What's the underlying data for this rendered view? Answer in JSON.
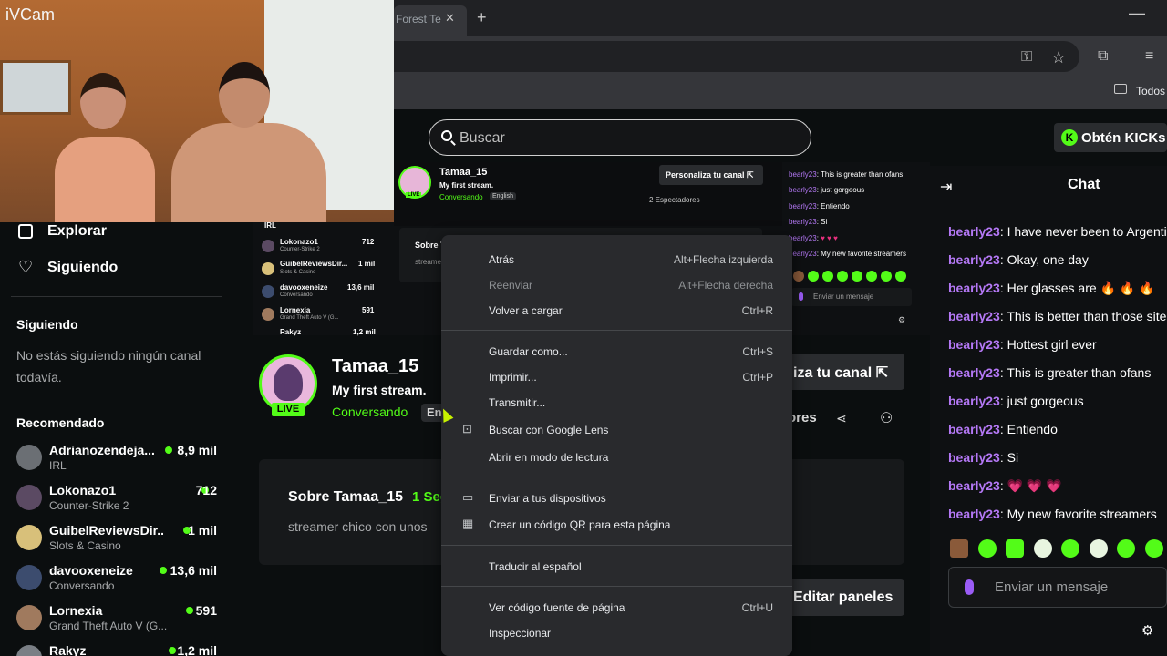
{
  "browser": {
    "tab_title": "Forest Te",
    "tab_close": "✕",
    "new_tab": "+",
    "minimize": "—",
    "bookmarks_label": "Todos"
  },
  "webcam": {
    "label": "iVCam"
  },
  "header": {
    "search_placeholder": "Buscar",
    "kicks_button": "Obtén KICKs",
    "kicks_logo": "K"
  },
  "sidebar": {
    "explore": "Explorar",
    "following": "Siguiendo",
    "following_heading": "Siguiendo",
    "not_following": "No estás siguiendo ningún canal todavía.",
    "recommended_heading": "Recomendado",
    "recommended": [
      {
        "name": "Adrianozendeja...",
        "category": "IRL",
        "viewers": "8,9 mil"
      },
      {
        "name": "Lokonazo1",
        "category": "Counter-Strike 2",
        "viewers": "712"
      },
      {
        "name": "GuibelReviewsDir...",
        "category": "Slots & Casino",
        "viewers": "1 mil"
      },
      {
        "name": "davooxeneize",
        "category": "Conversando",
        "viewers": "13,6 mil"
      },
      {
        "name": "Lornexia",
        "category": "Grand Theft Auto V (G...",
        "viewers": "591"
      },
      {
        "name": "Rakyz",
        "category": "",
        "viewers": "1,2 mil"
      }
    ]
  },
  "thumbnail": {
    "name": "Tamaa_15",
    "title": "My first stream.",
    "category": "Conversando",
    "language": "English",
    "live": "LIVE",
    "personalize": "Personaliza tu canal ⇱",
    "viewers": "2 Espectadores",
    "about_title": "Sobre T",
    "about_desc": "streame",
    "list": [
      {
        "name": "IRL",
        "sub": "",
        "num": ""
      },
      {
        "name": "Lokonazo1",
        "sub": "Counter-Strike 2",
        "num": "712"
      },
      {
        "name": "GuibelReviewsDir...",
        "sub": "Slots & Casino",
        "num": "1 mil"
      },
      {
        "name": "davooxeneize",
        "sub": "Conversando",
        "num": "13,6 mil"
      },
      {
        "name": "Lornexia",
        "sub": "Grand Theft Auto V (G...",
        "num": "591"
      },
      {
        "name": "Rakyz",
        "sub": "",
        "num": "1,2 mil"
      }
    ],
    "chat": [
      {
        "user": "bearly23",
        "text": "This is greater than ofans"
      },
      {
        "user": "bearly23",
        "text": "just gorgeous"
      },
      {
        "user": "bearly23",
        "text": "Entiendo"
      },
      {
        "user": "bearly23",
        "text": "Si"
      },
      {
        "user": "bearly23",
        "text": "♥ ♥ ♥"
      },
      {
        "user": "bearly23",
        "text": "My new favorite streamers"
      }
    ],
    "chat_placeholder": "Enviar un mensaje"
  },
  "channel": {
    "name": "Tamaa_15",
    "title": "My first stream.",
    "category": "Conversando",
    "language": "En",
    "live": "LIVE",
    "personalize": "iza tu canal ⇱",
    "viewers": "ores",
    "about_title": "Sobre Tamaa_15",
    "about_follow": "1 Seg",
    "about_desc": "streamer chico con unos",
    "edit_panels": "Editar paneles"
  },
  "chat": {
    "title": "Chat",
    "messages": [
      {
        "user": "bearly23",
        "text": "I have never been to Argentin"
      },
      {
        "user": "bearly23",
        "text": "Okay, one day"
      },
      {
        "user": "bearly23",
        "text": "Her glasses are 🔥 🔥 🔥"
      },
      {
        "user": "bearly23",
        "text": "This is better than those sites"
      },
      {
        "user": "bearly23",
        "text": "Hottest girl ever"
      },
      {
        "user": "bearly23",
        "text": "This is greater than ofans"
      },
      {
        "user": "bearly23",
        "text": "just gorgeous"
      },
      {
        "user": "bearly23",
        "text": "Entiendo"
      },
      {
        "user": "bearly23",
        "text": "Si"
      },
      {
        "user": "bearly23",
        "text": "💗 💗 💗"
      },
      {
        "user": "bearly23",
        "text": "My new favorite streamers"
      }
    ],
    "placeholder": "Enviar un mensaje"
  },
  "context_menu": {
    "items": [
      {
        "label": "Atrás",
        "shortcut": "Alt+Flecha izquierda"
      },
      {
        "label": "Reenviar",
        "shortcut": "Alt+Flecha derecha"
      },
      {
        "label": "Volver a cargar",
        "shortcut": "Ctrl+R"
      },
      {
        "label": "Guardar como...",
        "shortcut": "Ctrl+S"
      },
      {
        "label": "Imprimir...",
        "shortcut": "Ctrl+P"
      },
      {
        "label": "Transmitir...",
        "shortcut": ""
      },
      {
        "label": "Buscar con Google Lens",
        "shortcut": ""
      },
      {
        "label": "Abrir en modo de lectura",
        "shortcut": ""
      },
      {
        "label": "Enviar a tus dispositivos",
        "shortcut": ""
      },
      {
        "label": "Crear un código QR para esta página",
        "shortcut": ""
      },
      {
        "label": "Traducir al español",
        "shortcut": ""
      },
      {
        "label": "Ver código fuente de página",
        "shortcut": "Ctrl+U"
      },
      {
        "label": "Inspeccionar",
        "shortcut": ""
      }
    ]
  },
  "colors": {
    "brand_green": "#53fc18",
    "username_purple": "#b478f5",
    "menu_bg": "#292a2d"
  }
}
